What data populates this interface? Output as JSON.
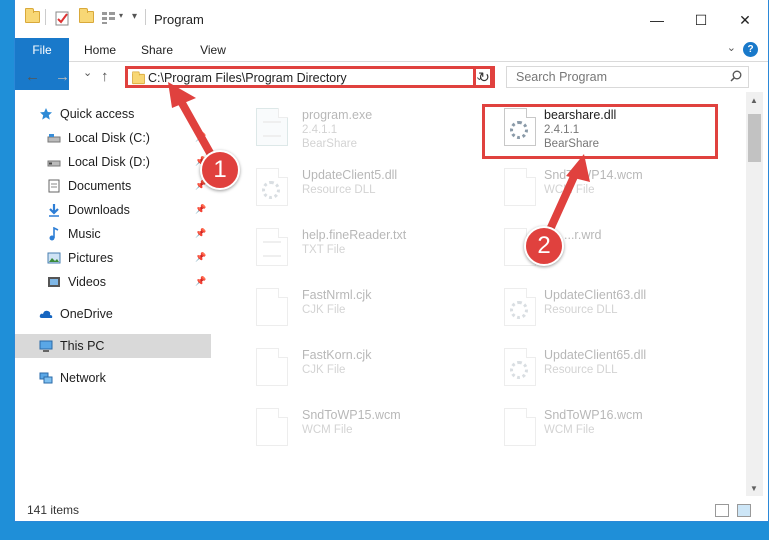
{
  "window": {
    "title": "Program",
    "minimize": "—",
    "maximize": "☐",
    "close": "✕"
  },
  "ribbon": {
    "tabs": [
      {
        "label": "File"
      },
      {
        "label": "Home"
      },
      {
        "label": "Share"
      },
      {
        "label": "View"
      }
    ],
    "help": "?"
  },
  "navbar": {
    "back": "←",
    "forward": "→",
    "recent": "⌄",
    "up": "↑",
    "address": "C:\\Program Files\\Program Directory",
    "refresh": "↻",
    "search_placeholder": "Search Program"
  },
  "navpane": {
    "items": [
      {
        "label": "Quick access",
        "icon": "star-icon",
        "pinned": false
      },
      {
        "label": "Local Disk (C:)",
        "icon": "drive-icon",
        "pinned": true
      },
      {
        "label": "Local Disk (D:)",
        "icon": "drive-icon",
        "pinned": true
      },
      {
        "label": "Documents",
        "icon": "documents-icon",
        "pinned": true
      },
      {
        "label": "Downloads",
        "icon": "download-icon",
        "pinned": true
      },
      {
        "label": "Music",
        "icon": "music-icon",
        "pinned": true
      },
      {
        "label": "Pictures",
        "icon": "pictures-icon",
        "pinned": true
      },
      {
        "label": "Videos",
        "icon": "videos-icon",
        "pinned": true
      },
      {
        "label": "OneDrive",
        "icon": "cloud-icon",
        "pinned": false
      },
      {
        "label": "This PC",
        "icon": "computer-icon",
        "pinned": false,
        "selected": true
      },
      {
        "label": "Network",
        "icon": "network-icon",
        "pinned": false
      }
    ]
  },
  "files": [
    {
      "name": "program.exe",
      "line1": "2.4.1.1",
      "line2": "BearShare",
      "type": "exe",
      "faded": true
    },
    {
      "name": "bearshare.dll",
      "line1": "2.4.1.1",
      "line2": "BearShare",
      "type": "dll",
      "faded": false
    },
    {
      "name": "UpdateClient5.dll",
      "line1": "Resource DLL",
      "line2": "",
      "type": "dll",
      "faded": true
    },
    {
      "name": "SndToWP14.wcm",
      "line1": "WCM File",
      "line2": "",
      "type": "doc",
      "faded": true
    },
    {
      "name": "help.fineReader.txt",
      "line1": "TXT File",
      "line2": "",
      "type": "doc",
      "faded": true
    },
    {
      "name": "...r.wrd",
      "line1": "",
      "line2": "",
      "type": "doc",
      "faded": true
    },
    {
      "name": "FastNrml.cjk",
      "line1": "CJK File",
      "line2": "",
      "type": "doc",
      "faded": true
    },
    {
      "name": "UpdateClient63.dll",
      "line1": "Resource DLL",
      "line2": "",
      "type": "dll",
      "faded": true
    },
    {
      "name": "FastKorn.cjk",
      "line1": "CJK File",
      "line2": "",
      "type": "doc",
      "faded": true
    },
    {
      "name": "UpdateClient65.dll",
      "line1": "Resource DLL",
      "line2": "",
      "type": "dll",
      "faded": true
    },
    {
      "name": "SndToWP15.wcm",
      "line1": "WCM File",
      "line2": "",
      "type": "doc",
      "faded": true
    },
    {
      "name": "SndToWP16.wcm",
      "line1": "WCM File",
      "line2": "",
      "type": "doc",
      "faded": true
    }
  ],
  "status": {
    "count": "141 items"
  },
  "annotations": {
    "step1": "1",
    "step2": "2",
    "color": "#e0413e"
  }
}
